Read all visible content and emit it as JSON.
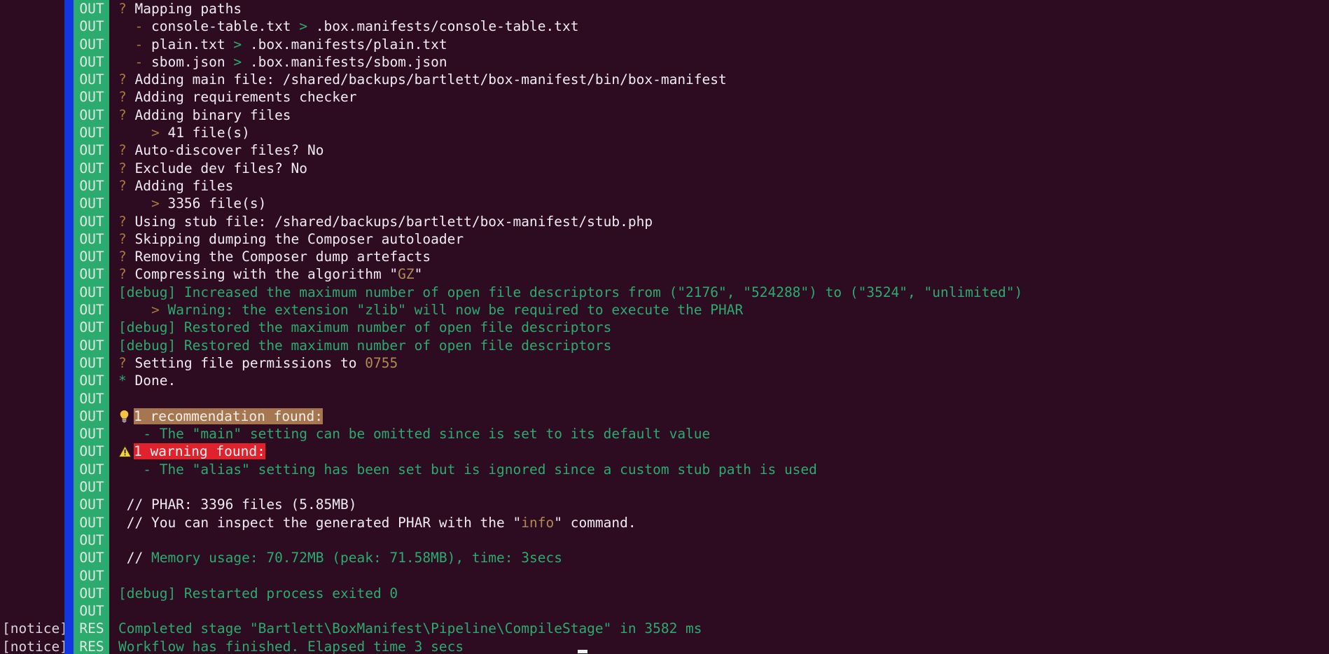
{
  "terminal": {
    "background_color": "#2d0b21",
    "badge_color": "#2cab6e",
    "accent_bar_color": "#1336e0",
    "text_color": "#f1ecf2",
    "green_color": "#2cab6e",
    "tan_color": "#a5793f",
    "recommendation_highlight_color": "#a5764f",
    "warning_highlight_color": "#e0222c",
    "out_badge_label": "OUT",
    "res_badge_label": "RES",
    "notice_label": "[notice]"
  },
  "lines": [
    {
      "badge": "OUT",
      "segments": [
        {
          "t": "? ",
          "c": "tan"
        },
        {
          "t": "Mapping paths",
          "c": "white"
        }
      ]
    },
    {
      "badge": "OUT",
      "segments": [
        {
          "t": "  - ",
          "c": "tan"
        },
        {
          "t": "console-table.txt ",
          "c": "white"
        },
        {
          "t": ">",
          "c": "green"
        },
        {
          "t": " .box.manifests/console-table.txt",
          "c": "white"
        }
      ]
    },
    {
      "badge": "OUT",
      "segments": [
        {
          "t": "  - ",
          "c": "tan"
        },
        {
          "t": "plain.txt ",
          "c": "white"
        },
        {
          "t": ">",
          "c": "green"
        },
        {
          "t": " .box.manifests/plain.txt",
          "c": "white"
        }
      ]
    },
    {
      "badge": "OUT",
      "segments": [
        {
          "t": "  - ",
          "c": "tan"
        },
        {
          "t": "sbom.json ",
          "c": "white"
        },
        {
          "t": ">",
          "c": "green"
        },
        {
          "t": " .box.manifests/sbom.json",
          "c": "white"
        }
      ]
    },
    {
      "badge": "OUT",
      "segments": [
        {
          "t": "? ",
          "c": "tan"
        },
        {
          "t": "Adding main file: /shared/backups/bartlett/box-manifest/bin/box-manifest",
          "c": "white"
        }
      ]
    },
    {
      "badge": "OUT",
      "segments": [
        {
          "t": "? ",
          "c": "tan"
        },
        {
          "t": "Adding requirements checker",
          "c": "white"
        }
      ]
    },
    {
      "badge": "OUT",
      "segments": [
        {
          "t": "? ",
          "c": "tan"
        },
        {
          "t": "Adding binary files",
          "c": "white"
        }
      ]
    },
    {
      "badge": "OUT",
      "segments": [
        {
          "t": "    > ",
          "c": "tan"
        },
        {
          "t": "41 file(s)",
          "c": "white"
        }
      ]
    },
    {
      "badge": "OUT",
      "segments": [
        {
          "t": "? ",
          "c": "tan"
        },
        {
          "t": "Auto-discover files? No",
          "c": "white"
        }
      ]
    },
    {
      "badge": "OUT",
      "segments": [
        {
          "t": "? ",
          "c": "tan"
        },
        {
          "t": "Exclude dev files? No",
          "c": "white"
        }
      ]
    },
    {
      "badge": "OUT",
      "segments": [
        {
          "t": "? ",
          "c": "tan"
        },
        {
          "t": "Adding files",
          "c": "white"
        }
      ]
    },
    {
      "badge": "OUT",
      "segments": [
        {
          "t": "    > ",
          "c": "tan"
        },
        {
          "t": "3356 file(s)",
          "c": "white"
        }
      ]
    },
    {
      "badge": "OUT",
      "segments": [
        {
          "t": "? ",
          "c": "tan"
        },
        {
          "t": "Using stub file: /shared/backups/bartlett/box-manifest/stub.php",
          "c": "white"
        }
      ]
    },
    {
      "badge": "OUT",
      "segments": [
        {
          "t": "? ",
          "c": "tan"
        },
        {
          "t": "Skipping dumping the Composer autoloader",
          "c": "white"
        }
      ]
    },
    {
      "badge": "OUT",
      "segments": [
        {
          "t": "? ",
          "c": "tan"
        },
        {
          "t": "Removing the Composer dump artefacts",
          "c": "white"
        }
      ]
    },
    {
      "badge": "OUT",
      "segments": [
        {
          "t": "? ",
          "c": "tan"
        },
        {
          "t": "Compressing with the algorithm \"",
          "c": "white"
        },
        {
          "t": "GZ",
          "c": "gold"
        },
        {
          "t": "\"",
          "c": "white"
        }
      ]
    },
    {
      "badge": "OUT",
      "segments": [
        {
          "t": "[debug] Increased the maximum number of open file descriptors from (\"2176\", \"524288\") to (\"3524\", \"unlimited\")",
          "c": "green"
        }
      ]
    },
    {
      "badge": "OUT",
      "segments": [
        {
          "t": "    > ",
          "c": "tan"
        },
        {
          "t": "Warning: the extension \"zlib\" will now be required to execute the PHAR",
          "c": "green"
        }
      ]
    },
    {
      "badge": "OUT",
      "segments": [
        {
          "t": "[debug] Restored the maximum number of open file descriptors",
          "c": "green"
        }
      ]
    },
    {
      "badge": "OUT",
      "segments": [
        {
          "t": "[debug] Restored the maximum number of open file descriptors",
          "c": "green"
        }
      ]
    },
    {
      "badge": "OUT",
      "segments": [
        {
          "t": "? ",
          "c": "tan"
        },
        {
          "t": "Setting file permissions to ",
          "c": "white"
        },
        {
          "t": "0755",
          "c": "gold"
        }
      ]
    },
    {
      "badge": "OUT",
      "segments": [
        {
          "t": "* ",
          "c": "green"
        },
        {
          "t": "Done.",
          "c": "white"
        }
      ]
    },
    {
      "badge": "OUT",
      "segments": []
    },
    {
      "badge": "OUT",
      "icon": "lightbulb-icon",
      "segments": [
        {
          "t": "1 recommendation found:",
          "c": "hl-rec"
        }
      ]
    },
    {
      "badge": "OUT",
      "segments": [
        {
          "t": "   - The \"main\" setting can be omitted since is set to its default value",
          "c": "green"
        }
      ]
    },
    {
      "badge": "OUT",
      "icon": "warning-triangle-icon",
      "segments": [
        {
          "t": "1 warning found:",
          "c": "hl-warn"
        }
      ]
    },
    {
      "badge": "OUT",
      "segments": [
        {
          "t": "   - The \"alias\" setting has been set but is ignored since a custom stub path is used",
          "c": "green"
        }
      ]
    },
    {
      "badge": "OUT",
      "segments": []
    },
    {
      "badge": "OUT",
      "segments": [
        {
          "t": " // PHAR: 3396 files (5.85MB)",
          "c": "white"
        }
      ]
    },
    {
      "badge": "OUT",
      "segments": [
        {
          "t": " // You can inspect the generated PHAR with the \"",
          "c": "white"
        },
        {
          "t": "info",
          "c": "gold"
        },
        {
          "t": "\" command.",
          "c": "white"
        }
      ]
    },
    {
      "badge": "OUT",
      "segments": []
    },
    {
      "badge": "OUT",
      "segments": [
        {
          "t": " // ",
          "c": "white"
        },
        {
          "t": "Memory usage: 70.72MB (peak: 71.58MB), time: 3secs",
          "c": "green"
        }
      ]
    },
    {
      "badge": "OUT",
      "segments": []
    },
    {
      "badge": "OUT",
      "segments": [
        {
          "t": "[debug] Restarted process exited 0",
          "c": "green"
        }
      ]
    },
    {
      "badge": "OUT",
      "segments": []
    },
    {
      "badge": "RES",
      "notice": "[notice]",
      "segments": [
        {
          "t": "Completed stage \"Bartlett\\BoxManifest\\Pipeline\\CompileStage\" in 3582 ms",
          "c": "green"
        }
      ]
    },
    {
      "badge": "RES",
      "notice": "[notice]",
      "segments": [
        {
          "t": "Workflow has finished. Elapsed time 3 secs",
          "c": "green"
        }
      ]
    }
  ]
}
